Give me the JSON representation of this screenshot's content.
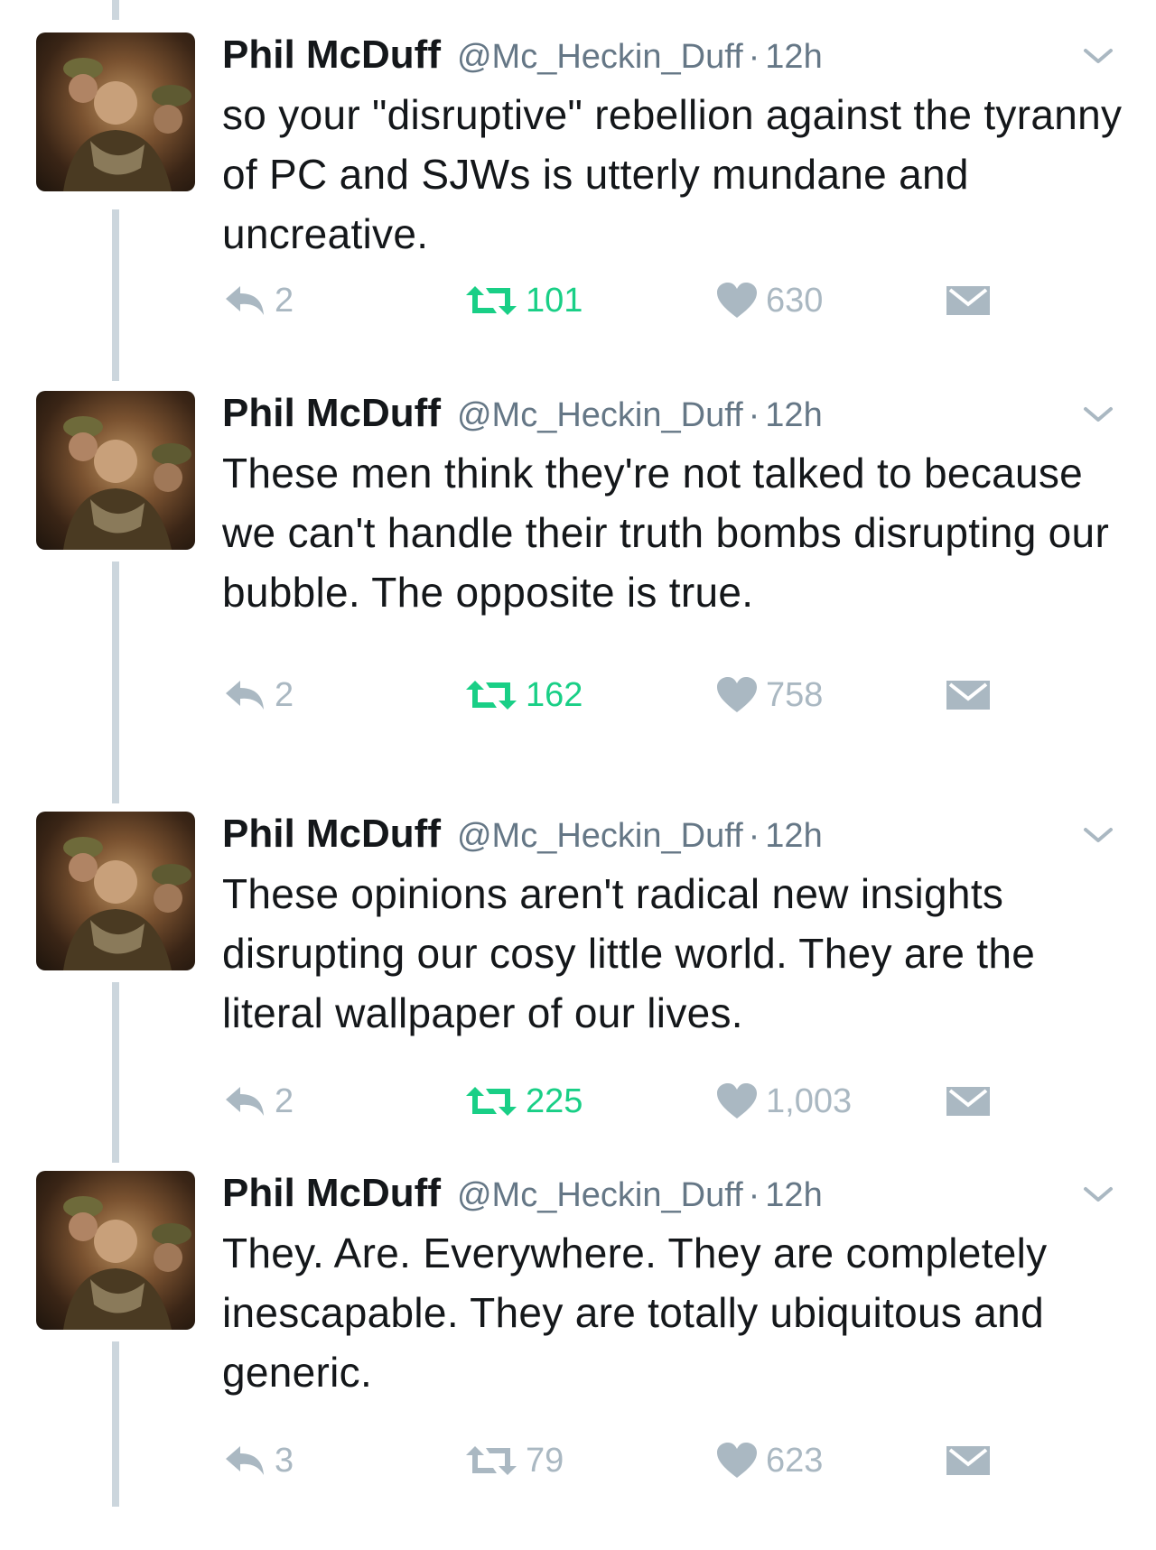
{
  "colors": {
    "name": "#14171a",
    "meta": "#657786",
    "action_gray": "#aab8c2",
    "retweet_green": "#19cf86",
    "thread_line": "#ccd6dd"
  },
  "icons": {
    "reply": "reply-arrow-icon",
    "retweet": "retweet-icon",
    "like": "heart-icon",
    "dm": "envelope-icon",
    "more": "chevron-down-icon"
  },
  "tweets": [
    {
      "name": "Phil McDuff",
      "handle": "@Mc_Heckin_Duff",
      "separator": "·",
      "time": "12h",
      "text": "so your \"disruptive\" rebellion against the tyranny of PC and SJWs is utterly mundane and uncreative.",
      "replies": "2",
      "retweets": "101",
      "likes": "630",
      "retweet_highlighted": true
    },
    {
      "name": "Phil McDuff",
      "handle": "@Mc_Heckin_Duff",
      "separator": "·",
      "time": "12h",
      "text": "These men think they're not talked to because we can't handle their truth bombs disrupting our bubble. The opposite is true.",
      "replies": "2",
      "retweets": "162",
      "likes": "758",
      "retweet_highlighted": true
    },
    {
      "name": "Phil McDuff",
      "handle": "@Mc_Heckin_Duff",
      "separator": "·",
      "time": "12h",
      "text": "These opinions aren't radical new insights disrupting our cosy little world. They are the literal wallpaper of our lives.",
      "replies": "2",
      "retweets": "225",
      "likes": "1,003",
      "retweet_highlighted": true
    },
    {
      "name": "Phil McDuff",
      "handle": "@Mc_Heckin_Duff",
      "separator": "·",
      "time": "12h",
      "text": "They. Are. Everywhere. They are completely inescapable. They are totally ubiquitous and generic.",
      "replies": "3",
      "retweets": "79",
      "likes": "623",
      "retweet_highlighted": false
    }
  ]
}
